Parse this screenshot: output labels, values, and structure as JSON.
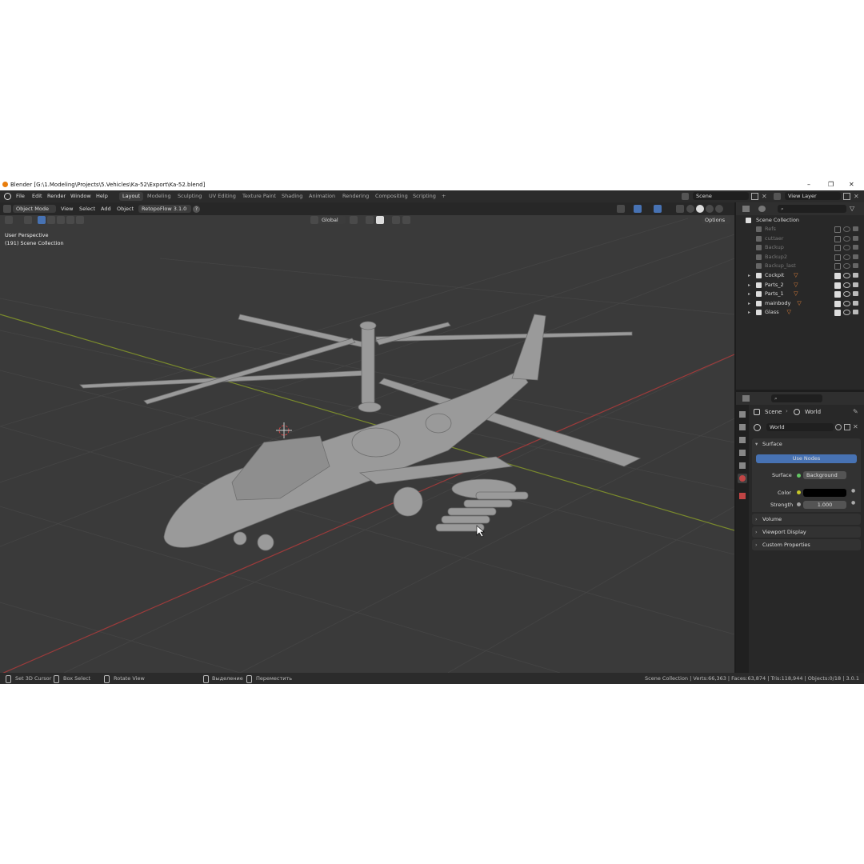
{
  "window": {
    "title": "Blender [G:\\1.Modeling\\Projects\\5.Vehicles\\Ka-52\\Export\\Ka-52.blend]",
    "minimize": "–",
    "maximize": "❐",
    "close": "✕"
  },
  "menu": [
    "File",
    "Edit",
    "Render",
    "Window",
    "Help"
  ],
  "workspaces": {
    "tabs": [
      "Layout",
      "Modeling",
      "Sculpting",
      "UV Editing",
      "Texture Paint",
      "Shading",
      "Animation",
      "Rendering",
      "Compositing",
      "Scripting"
    ],
    "active": "Layout",
    "add": "+"
  },
  "scene_selector": {
    "value": "Scene"
  },
  "view_layer_selector": {
    "value": "View Layer"
  },
  "viewport": {
    "mode": "Object Mode",
    "menus": [
      "View",
      "Select",
      "Add",
      "Object"
    ],
    "addon": "RetopoFlow 3.1.0",
    "addon_help": "?",
    "transform_orientation": "Global",
    "options": "Options",
    "perspective_label": "User Perspective",
    "collection_label": "(191) Scene Collection"
  },
  "outliner": {
    "root": "Scene Collection",
    "items": [
      {
        "name": "Refs",
        "enabled": false
      },
      {
        "name": "cuttaer",
        "enabled": false
      },
      {
        "name": "Backup",
        "enabled": false
      },
      {
        "name": "Backup2",
        "enabled": false
      },
      {
        "name": "Backup_last",
        "enabled": false
      },
      {
        "name": "Cockpit",
        "enabled": true
      },
      {
        "name": "Parts_2",
        "enabled": true
      },
      {
        "name": "Parts_1",
        "enabled": true
      },
      {
        "name": "mainbody",
        "enabled": true
      },
      {
        "name": "Glass",
        "enabled": true
      }
    ]
  },
  "properties": {
    "breadcrumb_scene": "Scene",
    "breadcrumb_sep": "›",
    "breadcrumb_world": "World",
    "world_name": "World",
    "surface_panel": "Surface",
    "use_nodes_button": "Use Nodes",
    "surface_label": "Surface",
    "surface_value": "Background",
    "color_label": "Color",
    "color_value": "#000000",
    "strength_label": "Strength",
    "strength_value": "1.000",
    "volume_panel": "Volume",
    "viewport_display_panel": "Viewport Display",
    "custom_properties_panel": "Custom Properties"
  },
  "statusbar": {
    "set_cursor": "Set 3D Cursor",
    "box_select": "Box Select",
    "rotate_view": "Rotate View",
    "select_ru": "Выделение",
    "move_ru": "Переместить",
    "stats": "Scene Collection | Verts:66,363 | Faces:63,874 | Tris:118,944 | Objects:0/18 | 3.0.1"
  },
  "colors": {
    "accent": "#4772b3",
    "viewport_bg": "#3a3a3a",
    "panel_bg": "#282828",
    "x_axis": "#9c3b3b",
    "y_axis": "#7a8a2c",
    "model": "#9a9a9a"
  }
}
